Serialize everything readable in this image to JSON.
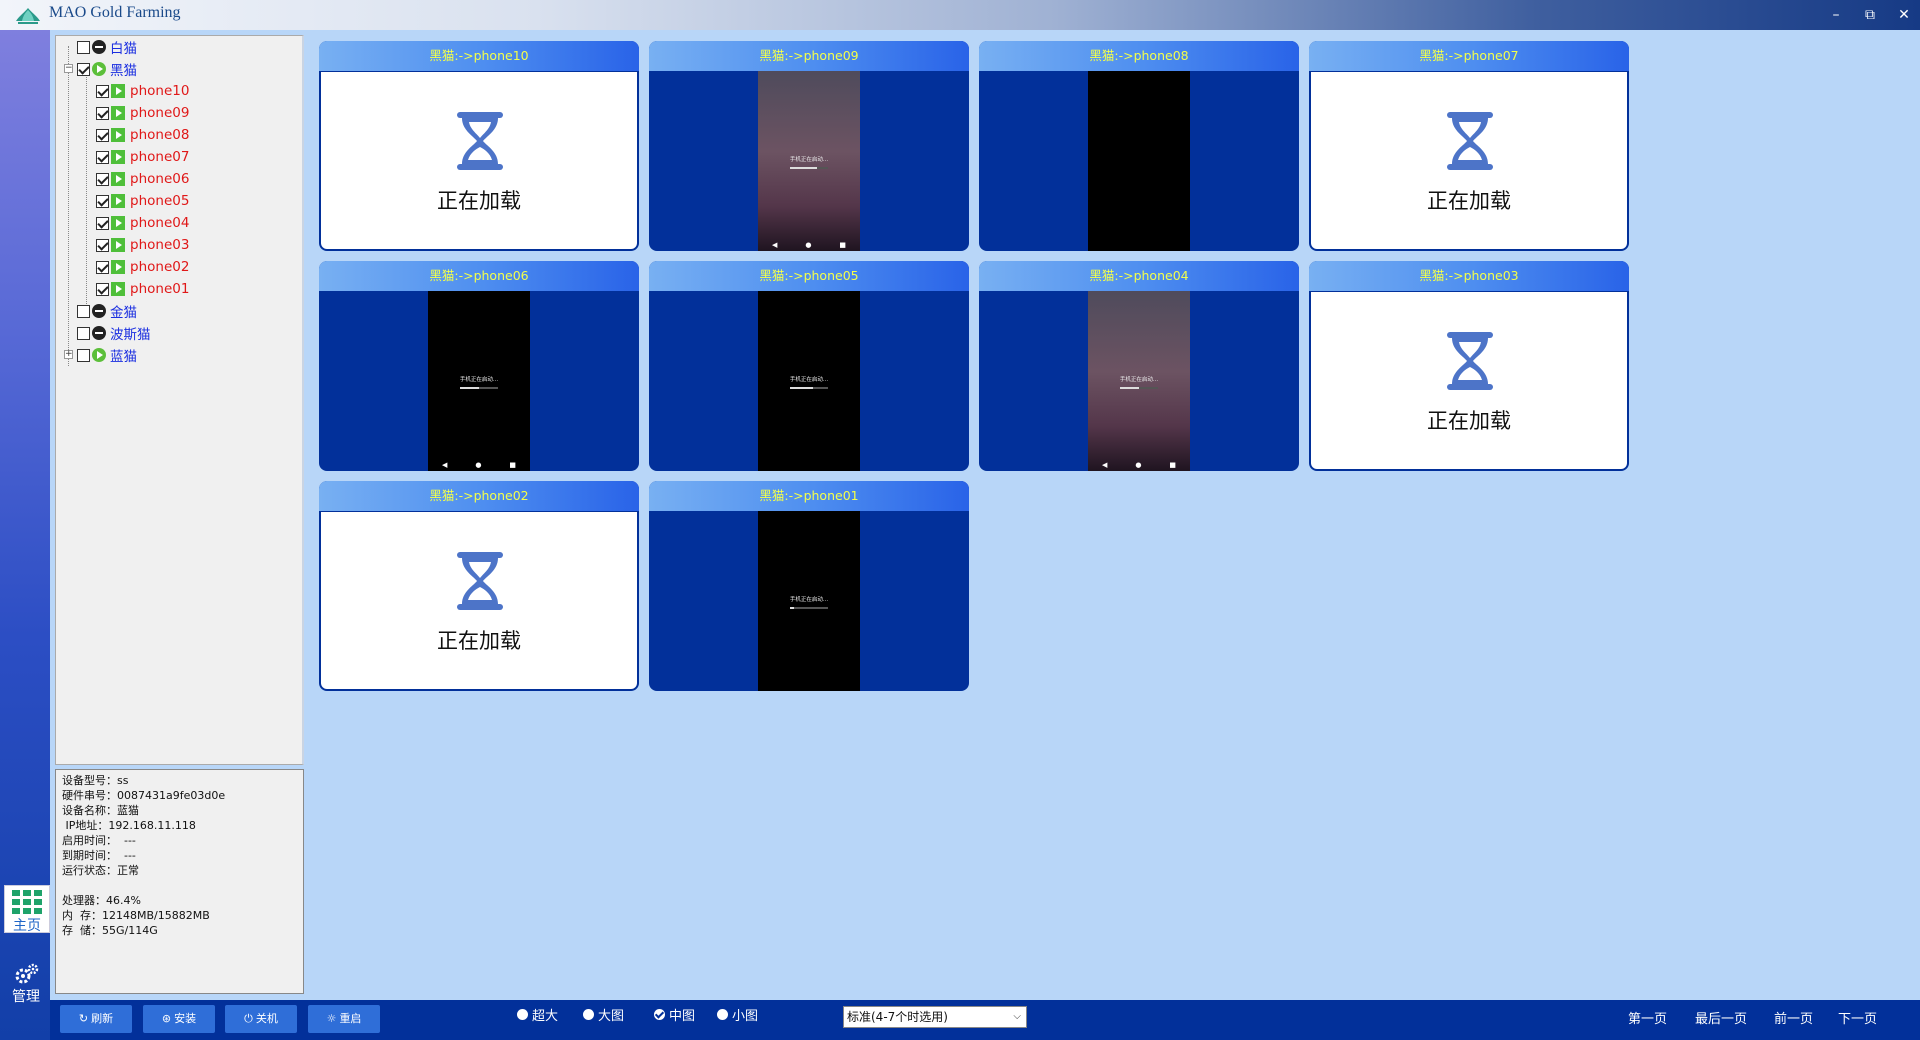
{
  "window": {
    "title": "MAO Gold Farming",
    "minimize": "–",
    "restore": "⧉",
    "close": "✕"
  },
  "sidebar": {
    "home_label": "主页",
    "manage_label": "管理"
  },
  "tree": {
    "groups": [
      {
        "label": "白猫",
        "checked": false,
        "status": "stopped"
      },
      {
        "label": "黑猫",
        "checked": true,
        "status": "running",
        "expanded": true
      },
      {
        "label": "金猫",
        "checked": false,
        "status": "stopped"
      },
      {
        "label": "波斯猫",
        "checked": false,
        "status": "stopped"
      },
      {
        "label": "蓝猫",
        "checked": false,
        "status": "running",
        "expanded": false
      }
    ],
    "devices": [
      "phone10",
      "phone09",
      "phone08",
      "phone07",
      "phone06",
      "phone05",
      "phone04",
      "phone03",
      "phone02",
      "phone01"
    ]
  },
  "info": {
    "model": "设备型号：ss",
    "serial": "硬件串号：0087431a9fe03d0e",
    "name": "设备名称：蓝猫",
    "ip": " IP地址：192.168.11.118",
    "start_time": "启用时间：  ---",
    "expire_time": "到期时间：  ---",
    "status": "运行状态：正常",
    "cpu": "处理器：46.4%",
    "memory": "内  存：12148MB/15882MB",
    "storage": "存  储：55G/114G"
  },
  "cards": [
    {
      "title": "黑猫:->phone10",
      "state": "loading"
    },
    {
      "title": "黑猫:->phone09",
      "state": "screen",
      "screen_style": "purple",
      "boot_text": "手机正在启动...",
      "progress": 0.7
    },
    {
      "title": "黑猫:->phone08",
      "state": "screen",
      "screen_style": "black"
    },
    {
      "title": "黑猫:->phone07",
      "state": "loading"
    },
    {
      "title": "黑猫:->phone06",
      "state": "screen",
      "screen_style": "black",
      "boot_text": "手机正在启动...",
      "progress": 0.5
    },
    {
      "title": "黑猫:->phone05",
      "state": "screen",
      "screen_style": "black",
      "boot_text": "手机正在启动...",
      "progress": 0.6
    },
    {
      "title": "黑猫:->phone04",
      "state": "screen",
      "screen_style": "purple",
      "boot_text": "手机正在启动...",
      "progress": 0.5
    },
    {
      "title": "黑猫:->phone03",
      "state": "loading"
    },
    {
      "title": "黑猫:->phone02",
      "state": "loading"
    },
    {
      "title": "黑猫:->phone01",
      "state": "screen",
      "screen_style": "black",
      "boot_text": "手机正在启动...",
      "progress": 0.1
    }
  ],
  "loading_text": "正在加载",
  "toolbar": {
    "refresh": "刷新",
    "install": "安装",
    "shutdown": "关机",
    "restart": "重启"
  },
  "size_options": [
    {
      "label": "超大",
      "selected": false
    },
    {
      "label": "大图",
      "selected": false
    },
    {
      "label": "中图",
      "selected": true
    },
    {
      "label": "小图",
      "selected": false
    }
  ],
  "layout_select": {
    "value": "标准(4-7个时选用)"
  },
  "pager": {
    "first": "第一页",
    "last": "最后一页",
    "prev": "前一页",
    "next": "下一页"
  },
  "colors": {
    "accent": "#02309a",
    "card_title": "#f4ff4a",
    "group_label": "#1a2ee0",
    "device_label": "#e01818",
    "canvas_bg": "#b8d6f8"
  }
}
